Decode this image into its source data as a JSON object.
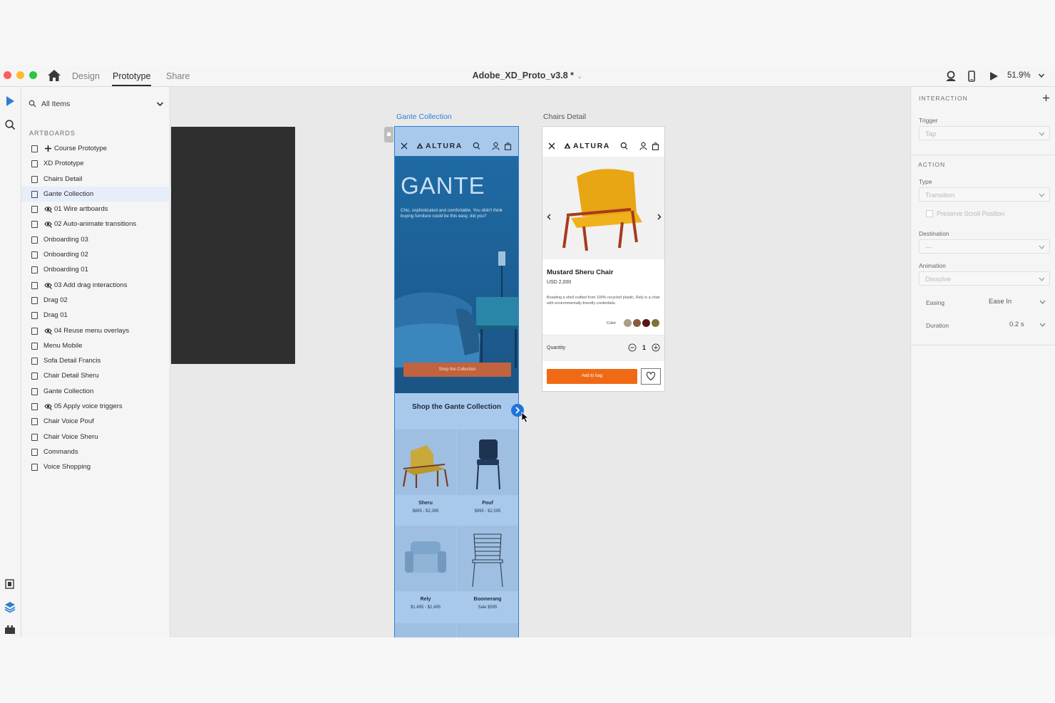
{
  "titlebar": {
    "modes": [
      "Design",
      "Prototype",
      "Share"
    ],
    "active_mode": "Prototype",
    "document_title": "Adobe_XD_Proto_v3.8 *",
    "zoom": "51.9%"
  },
  "layers": {
    "search_placeholder": "All Items",
    "section_label": "ARTBOARDS",
    "items": [
      {
        "label": "Course Prototype",
        "prefix": "plus-icon"
      },
      {
        "label": "XD Prototype"
      },
      {
        "label": "Chairs Detail"
      },
      {
        "label": "Gante Collection",
        "selected": true
      },
      {
        "label": "01 Wire artboards",
        "prefix": "eye-icon"
      },
      {
        "label": "02 Auto-animate transitions",
        "prefix": "eye-icon"
      },
      {
        "label": "Onboarding 03"
      },
      {
        "label": "Onboarding 02"
      },
      {
        "label": "Onboarding 01"
      },
      {
        "label": "03 Add drag interactions",
        "prefix": "eye-icon"
      },
      {
        "label": "Drag 02"
      },
      {
        "label": "Drag 01"
      },
      {
        "label": "04 Reuse menu overlays",
        "prefix": "eye-icon"
      },
      {
        "label": "Menu Mobile"
      },
      {
        "label": "Sofa Detail Francis"
      },
      {
        "label": "Chair Detail Sheru"
      },
      {
        "label": "Gante Collection"
      },
      {
        "label": "05 Apply voice triggers",
        "prefix": "eye-icon"
      },
      {
        "label": "Chair Voice Pouf"
      },
      {
        "label": "Chair Voice Sheru"
      },
      {
        "label": "Commands"
      },
      {
        "label": "Voice Shopping"
      }
    ]
  },
  "canvas": {
    "gante": {
      "artboard_title": "Gante Collection",
      "brand": "ALTURA",
      "hero_title": "GANTE",
      "hero_copy": "Chic, sophisticated and comfortable. You didn't think buying furniture could be this easy, did you?",
      "hero_cta": "Shop the Collection",
      "shop_title": "Shop the Gante Collection",
      "products": [
        {
          "name": "Sheru",
          "price": "$895 - $2,395"
        },
        {
          "name": "Pouf",
          "price": "$995 - $2,595"
        },
        {
          "name": "Rely",
          "price": "$1,495 - $2,495"
        },
        {
          "name": "Boomerang",
          "price": "Sale $595"
        }
      ]
    },
    "chairs": {
      "artboard_title": "Chairs Detail",
      "brand": "ALTURA",
      "product_name": "Mustard Sheru Chair",
      "price": "USD 2,000",
      "description": "Boasting a shell crafted from 100% recycled plastic, Rely is a chair with environmentally-friendly credentials.",
      "color_label": "Color",
      "swatches": [
        "#a79f86",
        "#8a5a3b",
        "#5c1616",
        "#7d7337"
      ],
      "quantity_label": "Quantity",
      "quantity_value": "1",
      "add_label": "Add to bag"
    }
  },
  "inspector": {
    "interaction_label": "INTERACTION",
    "trigger_label": "Trigger",
    "trigger_value": "Tap",
    "action_label": "ACTION",
    "type_label": "Type",
    "type_value": "Transition",
    "preserve_label": "Preserve Scroll Position",
    "destination_label": "Destination",
    "destination_value": "—",
    "animation_label": "Animation",
    "animation_value": "Dissolve",
    "easing_label": "Easing",
    "easing_value": "Ease In",
    "duration_label": "Duration",
    "duration_value": "0.2 s"
  },
  "colors": {
    "accent": "#2d7fd6",
    "cta_orange": "#f06a15",
    "hero_blue": "#1f6aa4"
  }
}
